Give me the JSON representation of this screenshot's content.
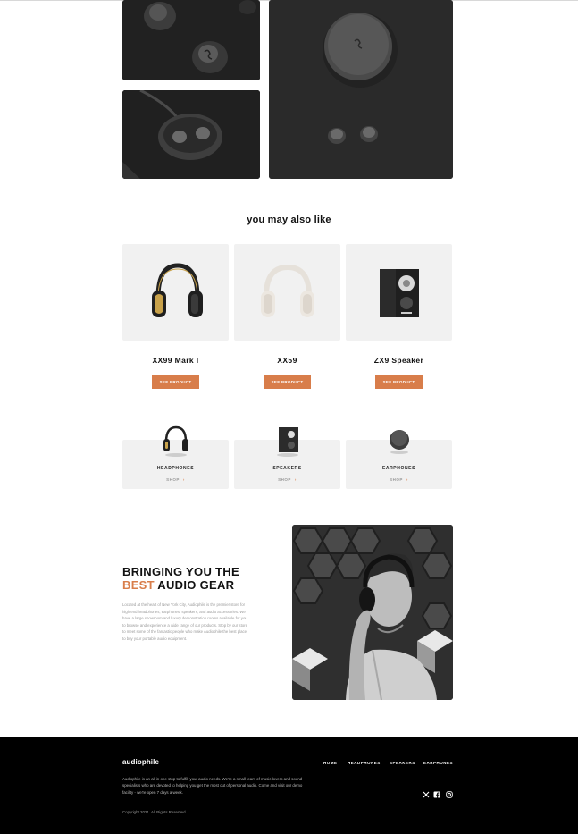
{
  "also_like": {
    "title": "you may also like",
    "products": [
      {
        "name": "XX99 Mark I",
        "button": "See product"
      },
      {
        "name": "XX59",
        "button": "See product"
      },
      {
        "name": "ZX9 Speaker",
        "button": "See product"
      }
    ]
  },
  "categories": [
    {
      "label": "HEADPHONES",
      "shop": "SHOP",
      "chevron": "›"
    },
    {
      "label": "SPEAKERS",
      "shop": "SHOP",
      "chevron": "›"
    },
    {
      "label": "EARPHONES",
      "shop": "SHOP",
      "chevron": "›"
    }
  ],
  "about": {
    "title_line1": "BRINGING YOU THE",
    "title_accent": "BEST",
    "title_rest": " AUDIO GEAR",
    "text": "Located at the heart of New York City, Audiophile is the premier store for high end headphones, earphones, speakers, and audio accessories. We have a large showroom and luxury demonstration rooms available for you to browse and experience a wide range of our products. Stop by our store to meet some of the fantastic people who make Audiophile the best place to buy your portable audio equipment."
  },
  "footer": {
    "logo": "audiophile",
    "nav": [
      "HOME",
      "HEADPHONES",
      "SPEAKERS",
      "EARPHONES"
    ],
    "text": "Audiophile is an all in one stop to fulfill your audio needs. We're a small team of music lovers and sound specialists who are devoted to helping you get the most out of personal audio. Come and visit our demo facility - we're open 7 days a week.",
    "copyright": "Copyright 2021. All Rights Reserved",
    "social": [
      "x-icon",
      "facebook-icon",
      "instagram-icon"
    ]
  },
  "colors": {
    "accent": "#d87d4a",
    "card_bg": "#f1f1f1",
    "footer_bg": "#000000"
  }
}
